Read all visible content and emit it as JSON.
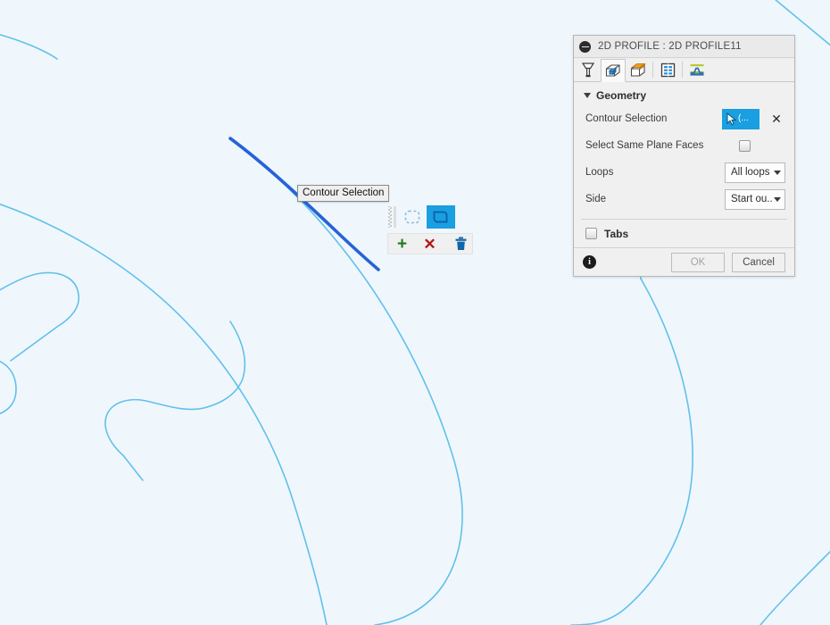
{
  "app": {
    "background_color": "#eff7fd",
    "sketch_curve_color": "#62c0ea",
    "selected_contour_color": "#2563d9",
    "accent_color": "#1a9fe0"
  },
  "canvas": {
    "name": "cad-viewport",
    "tooltip": {
      "label": "Contour Selection"
    }
  },
  "mini_toolbar": {
    "drag_handle_name": "drag-handle",
    "modes": [
      {
        "name": "chain-selection-mode",
        "label": "Chain selection",
        "active": false
      },
      {
        "name": "single-selection-mode",
        "label": "Single selection",
        "active": true
      }
    ],
    "actions": [
      {
        "name": "add-selection-button",
        "glyph": "+",
        "label": "Add"
      },
      {
        "name": "remove-selection-button",
        "glyph": "✕",
        "label": "Remove"
      },
      {
        "name": "delete-selection-button",
        "glyph": "trash",
        "label": "Delete"
      }
    ]
  },
  "dialog": {
    "title": "2D PROFILE : 2D PROFILE11",
    "collapse_label": "Collapse",
    "tabs": [
      {
        "id": "tool",
        "icon": "endmill-tool-icon",
        "label": "Tool",
        "active": false
      },
      {
        "id": "geometry",
        "icon": "geometry-cube-icon",
        "label": "Geometry",
        "active": true
      },
      {
        "id": "heights",
        "icon": "heights-stock-icon",
        "label": "Heights",
        "active": false
      },
      {
        "id": "passes",
        "icon": "passes-layers-icon",
        "label": "Passes",
        "active": false
      },
      {
        "id": "linking",
        "icon": "linking-ramp-icon",
        "label": "Linking",
        "active": false
      }
    ],
    "geometry": {
      "section_title": "Geometry",
      "rows": [
        {
          "name": "contour-selection",
          "label": "Contour Selection",
          "control": "select-button",
          "button_text": "(...",
          "clear_glyph": "✕"
        },
        {
          "name": "select-same-plane-faces",
          "label": "Select Same Plane Faces",
          "control": "checkbox",
          "checked": false
        },
        {
          "name": "loops",
          "label": "Loops",
          "control": "dropdown",
          "value": "All loops"
        },
        {
          "name": "side",
          "label": "Side",
          "control": "dropdown",
          "value": "Start ou..."
        }
      ]
    },
    "tabs_group": {
      "name": "tabs-group",
      "label": "Tabs",
      "checked": false
    },
    "footer": {
      "info_glyph": "i",
      "ok_label": "OK",
      "cancel_label": "Cancel",
      "ok_disabled": true
    }
  }
}
